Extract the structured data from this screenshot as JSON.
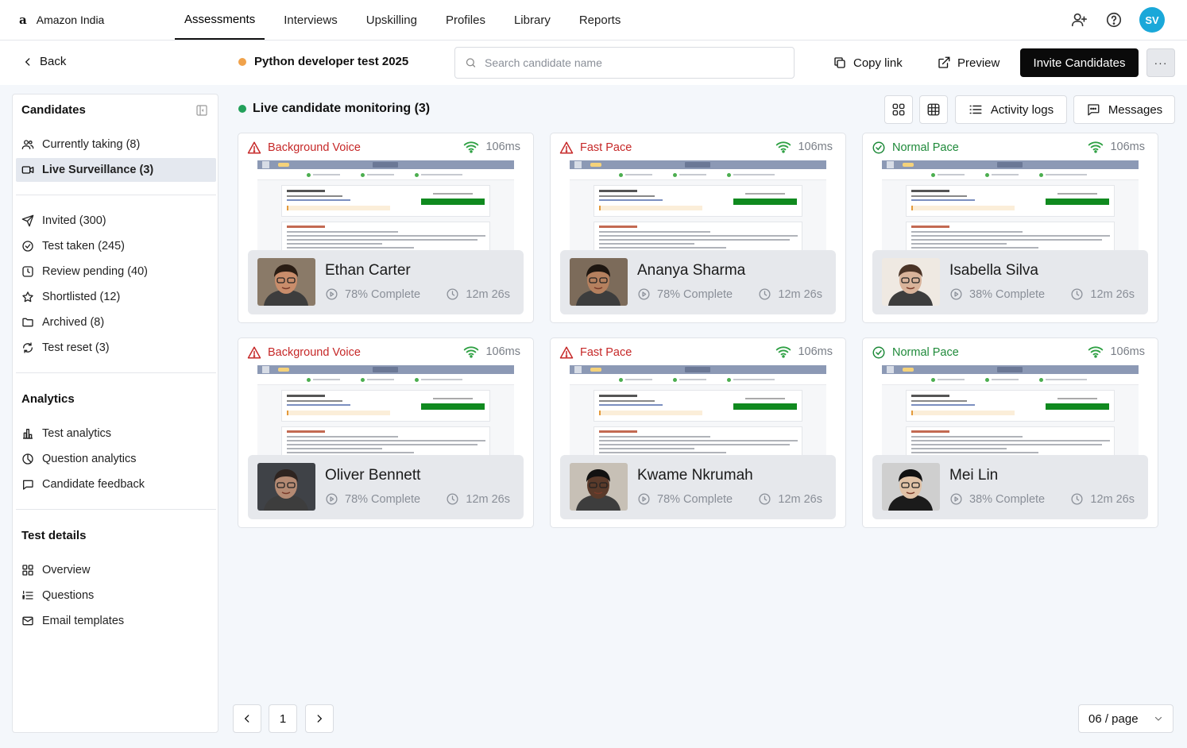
{
  "brand": {
    "logo": "a",
    "name": "Amazon India"
  },
  "nav": [
    {
      "label": "Assessments",
      "active": true
    },
    {
      "label": "Interviews"
    },
    {
      "label": "Upskilling"
    },
    {
      "label": "Profiles"
    },
    {
      "label": "Library"
    },
    {
      "label": "Reports"
    }
  ],
  "user": {
    "initials": "SV",
    "avatar_color": "#1aa8d9"
  },
  "toolbar": {
    "back_label": "Back",
    "test_title": "Python developer test 2025",
    "status_color": "#f0a24b",
    "search_placeholder": "Search candidate name",
    "copy_link_label": "Copy link",
    "preview_label": "Preview",
    "invite_label": "Invite Candidates",
    "more_label": "···"
  },
  "sidebar": {
    "candidates_heading": "Candidates",
    "candidate_items": [
      {
        "label": "Currently taking (8)",
        "icon": "users-icon"
      },
      {
        "label": "Live Surveillance (3)",
        "icon": "video-icon",
        "active": true
      },
      {
        "label": "Invited (300)",
        "icon": "send-icon"
      },
      {
        "label": "Test taken (245)",
        "icon": "check-circle-icon"
      },
      {
        "label": "Review pending (40)",
        "icon": "clock-icon"
      },
      {
        "label": "Shortlisted (12)",
        "icon": "star-icon"
      },
      {
        "label": "Archived (8)",
        "icon": "folder-icon"
      },
      {
        "label": "Test reset (3)",
        "icon": "refresh-icon"
      }
    ],
    "analytics_heading": "Analytics",
    "analytics_items": [
      {
        "label": "Test analytics",
        "icon": "bar-chart-icon"
      },
      {
        "label": "Question analytics",
        "icon": "pie-icon"
      },
      {
        "label": "Candidate feedback",
        "icon": "chat-icon"
      }
    ],
    "details_heading": "Test details",
    "details_items": [
      {
        "label": "Overview",
        "icon": "grid-icon"
      },
      {
        "label": "Questions",
        "icon": "list-icon"
      },
      {
        "label": "Email templates",
        "icon": "mail-icon"
      }
    ]
  },
  "main": {
    "heading": "Live candidate monitoring (3)",
    "activity_logs_label": "Activity logs",
    "messages_label": "Messages",
    "cards": [
      {
        "status": "Background Voice",
        "status_type": "warn",
        "latency": "106ms",
        "name": "Ethan Carter",
        "progress": "78% Complete",
        "time": "12m 26s"
      },
      {
        "status": "Fast Pace",
        "status_type": "warn",
        "latency": "106ms",
        "name": "Ananya Sharma",
        "progress": "78% Complete",
        "time": "12m 26s"
      },
      {
        "status": "Normal Pace",
        "status_type": "ok",
        "latency": "106ms",
        "name": "Isabella Silva",
        "progress": "38% Complete",
        "time": "12m 26s"
      },
      {
        "status": "Background Voice",
        "status_type": "warn",
        "latency": "106ms",
        "name": "Oliver Bennett",
        "progress": "78% Complete",
        "time": "12m 26s"
      },
      {
        "status": "Fast Pace",
        "status_type": "warn",
        "latency": "106ms",
        "name": "Kwame Nkrumah",
        "progress": "78% Complete",
        "time": "12m 26s"
      },
      {
        "status": "Normal Pace",
        "status_type": "ok",
        "latency": "106ms",
        "name": "Mei Lin",
        "progress": "38% Complete",
        "time": "12m 26s"
      }
    ]
  },
  "pagination": {
    "current_page": "1",
    "per_page": "06 / page"
  },
  "colors": {
    "warn": "#c62828",
    "ok": "#1f8a3a",
    "accent_dark": "#0a0a0a"
  }
}
